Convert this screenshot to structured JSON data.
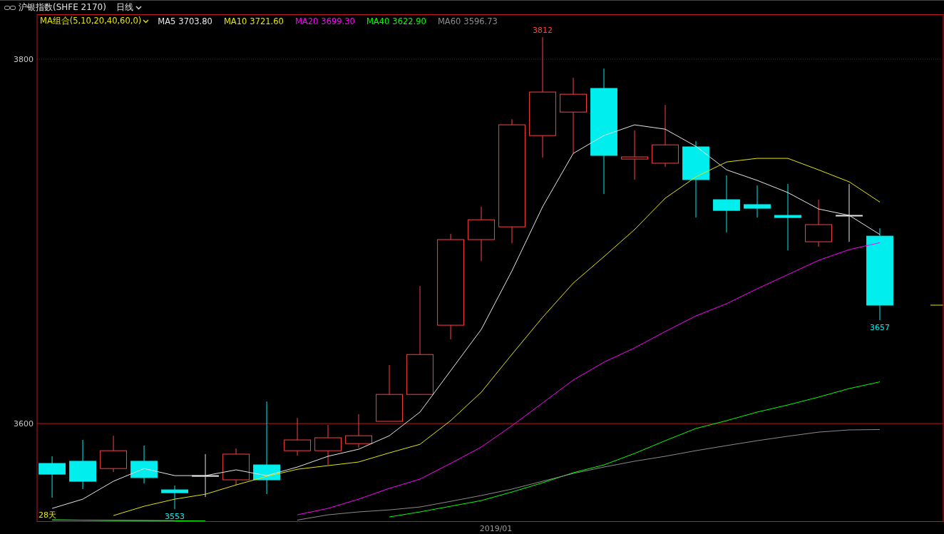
{
  "header": {
    "title": "沪银指数(SHFE 2170)",
    "period": "日线"
  },
  "chart": {
    "selector": "MA组合(5,10,20,40,60,0)",
    "legend": [
      {
        "value": "3703.80"
      },
      {
        "value": "3721.60"
      },
      {
        "value": "3699.30"
      },
      {
        "value": "3622.90"
      },
      {
        "value": "3596.73"
      }
    ],
    "period_label": "28天",
    "chart_data": {
      "type": "line",
      "xlabel": "2019/01",
      "ylim": [
        3546.4,
        3824.7
      ],
      "yticks": [
        3600,
        3800
      ],
      "series": [
        {
          "name": "MA5",
          "color": "#e6e6e6",
          "values": [
            3553.4,
            3558.5,
            3568.3,
            3575.3,
            3571.4,
            3571.4,
            3574.6,
            3571.4,
            3576.1,
            3582.0,
            3585.9,
            3593.3,
            3606.3,
            3629.0,
            3651.7,
            3683.8,
            3719.0,
            3748.3,
            3758.1,
            3764.0,
            3761.6,
            3752.2,
            3739.3,
            3733.5,
            3726.8,
            3717.8,
            3714.3,
            3703.8
          ]
        },
        {
          "name": "MA10",
          "color": "#e6e600",
          "values": [
            null,
            null,
            3549.5,
            3554.6,
            3558.5,
            3561.2,
            3566.3,
            3571.0,
            3574.9,
            3576.9,
            3578.9,
            3583.9,
            3588.6,
            3601.6,
            3617.2,
            3638.0,
            3658.3,
            3677.1,
            3691.6,
            3706.5,
            3723.7,
            3735.4,
            3743.6,
            3745.6,
            3745.6,
            3739.3,
            3732.7,
            3721.6
          ]
        },
        {
          "name": "MA20",
          "color": "#ff00ff",
          "values": [
            null,
            null,
            null,
            null,
            null,
            null,
            null,
            null,
            3549.9,
            3553.4,
            3558.5,
            3564.4,
            3569.5,
            3578.1,
            3587.1,
            3598.8,
            3611.3,
            3623.9,
            3633.7,
            3641.5,
            3650.5,
            3659.1,
            3665.8,
            3674.0,
            3681.8,
            3689.6,
            3695.5,
            3699.3
          ]
        },
        {
          "name": "MA40",
          "color": "#00ff00",
          "values": [
            3547.2,
            3547.0,
            3546.8,
            3546.7,
            3546.6,
            3546.5,
            null,
            null,
            null,
            null,
            null,
            3548.7,
            3551.5,
            3554.6,
            3557.7,
            3562.4,
            3567.5,
            3573.0,
            3577.3,
            3583.6,
            3590.6,
            3597.3,
            3601.6,
            3606.3,
            3610.2,
            3614.5,
            3619.2,
            3622.9
          ]
        },
        {
          "name": "MA60",
          "color": "#8c8c8c",
          "values": [
            3547.0,
            3546.9,
            3546.9,
            3546.8,
            3546.7,
            null,
            null,
            null,
            3547.0,
            3549.9,
            3551.5,
            3552.6,
            3554.2,
            3557.3,
            3560.5,
            3564.0,
            3568.3,
            3572.6,
            3576.1,
            3579.3,
            3582.0,
            3585.1,
            3587.9,
            3590.6,
            3593.0,
            3595.3,
            3596.5,
            3596.7
          ]
        },
        {
          "type": "candlestick",
          "ohlc": [
            [
              3578.1,
              3582.0,
              3559.3,
              3572.2
            ],
            [
              3579.3,
              3591.0,
              3564.0,
              3568.3
            ],
            [
              3575.3,
              3593.3,
              3573.4,
              3585.1
            ],
            [
              3579.3,
              3587.9,
              3567.1,
              3570.3
            ],
            [
              3563.6,
              3566.0,
              3553.0,
              3562.0
            ],
            [
              3571.4,
              3583.2,
              3559.7,
              3571.4
            ],
            [
              3569.1,
              3586.3,
              3566.3,
              3583.2
            ],
            [
              3577.3,
              3612.1,
              3561.3,
              3569.1
            ],
            [
              3585.1,
              3603.1,
              3582.4,
              3591.0
            ],
            [
              3585.1,
              3599.2,
              3577.3,
              3592.2
            ],
            [
              3589.0,
              3605.1,
              3586.7,
              3593.3
            ],
            [
              3601.2,
              3632.1,
              3601.2,
              3616.0
            ],
            [
              3616.0,
              3675.5,
              3616.0,
              3637.9
            ],
            [
              3654.0,
              3704.1,
              3646.2,
              3701.0
            ],
            [
              3701.0,
              3719.0,
              3689.2,
              3711.9
            ],
            [
              3708.0,
              3767.1,
              3699.0,
              3764.0
            ],
            [
              3758.1,
              3812.1,
              3746.0,
              3782.0
            ],
            [
              3771.0,
              3789.8,
              3748.3,
              3780.8
            ],
            [
              3784.0,
              3794.9,
              3726.0,
              3747.2
            ],
            [
              3745.2,
              3760.9,
              3733.9,
              3746.4
            ],
            [
              3742.9,
              3774.9,
              3740.9,
              3753.0
            ],
            [
              3751.9,
              3755.0,
              3713.1,
              3733.9
            ],
            [
              3722.9,
              3736.2,
              3704.9,
              3717.0
            ],
            [
              3720.2,
              3730.7,
              3713.1,
              3718.2
            ],
            [
              3714.3,
              3731.5,
              3695.1,
              3713.1
            ],
            [
              3699.8,
              3722.9,
              3697.1,
              3709.2
            ],
            [
              3714.3,
              3731.5,
              3699.8,
              3714.3
            ],
            [
              3702.9,
              3707.2,
              3656.7,
              3665.0
            ]
          ]
        }
      ],
      "ref_lines": [
        {
          "axis": "y",
          "value": 3800
        },
        {
          "axis": "y",
          "value": 3600,
          "color": "#c01818"
        }
      ],
      "annotations": [
        "3812",
        "3553",
        "3657"
      ]
    }
  }
}
